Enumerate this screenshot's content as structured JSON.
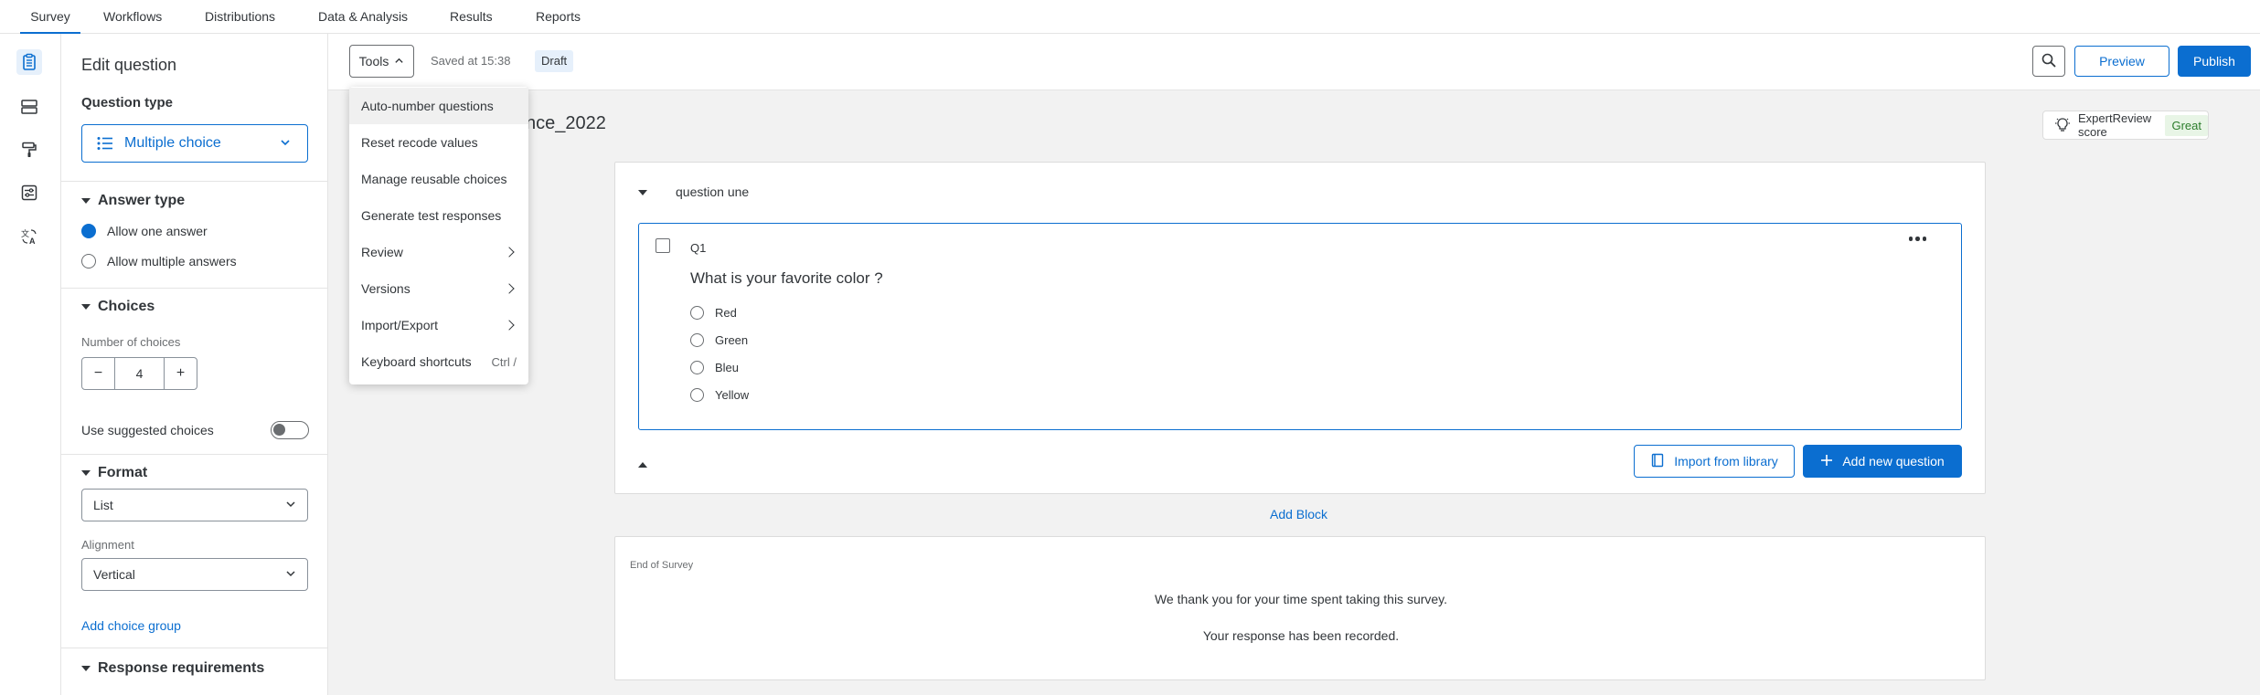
{
  "nav": {
    "tabs": [
      {
        "label": "Survey",
        "active": true
      },
      {
        "label": "Workflows"
      },
      {
        "label": "Distributions"
      },
      {
        "label": "Data & Analysis"
      },
      {
        "label": "Results"
      },
      {
        "label": "Reports"
      }
    ]
  },
  "rail": {
    "icons": [
      "survey-clipboard-icon",
      "blocks-icon",
      "paint-roller-icon",
      "survey-options-icon",
      "translate-icon"
    ]
  },
  "edit_panel": {
    "title": "Edit question",
    "question_type_heading": "Question type",
    "question_type_value": "Multiple choice",
    "answer_type": {
      "heading": "Answer type",
      "options": [
        {
          "label": "Allow one answer",
          "selected": true
        },
        {
          "label": "Allow multiple answers",
          "selected": false
        }
      ]
    },
    "choices": {
      "heading": "Choices",
      "number_label": "Number of choices",
      "number_value": "4",
      "minus": "−",
      "plus": "+",
      "suggested_label": "Use suggested choices",
      "suggested_on": false
    },
    "format": {
      "heading": "Format",
      "format_value": "List",
      "alignment_label": "Alignment",
      "alignment_value": "Vertical",
      "add_group_link": "Add choice group"
    },
    "response_requirements": "Response requirements"
  },
  "toolbar": {
    "tools_label": "Tools",
    "saved_text": "Saved at 15:38",
    "draft_badge": "Draft",
    "preview_label": "Preview",
    "publish_label": "Publish"
  },
  "tools_menu": {
    "items": [
      {
        "label": "Auto-number questions",
        "highlighted": true
      },
      {
        "label": "Reset recode values"
      },
      {
        "label": "Manage reusable choices"
      },
      {
        "label": "Generate test responses"
      },
      {
        "label": "Review",
        "submenu": true
      },
      {
        "label": "Versions",
        "submenu": true
      },
      {
        "label": "Import/Export",
        "submenu": true
      },
      {
        "label": "Keyboard shortcuts",
        "shortcut": "Ctrl /"
      }
    ]
  },
  "canvas": {
    "survey_title": "nce_2022",
    "expert_review": {
      "label": "ExpertReview score",
      "score": "Great"
    },
    "block": {
      "name": "question une",
      "question": {
        "id": "Q1",
        "text": "What is your favorite color ?",
        "choices": [
          "Red",
          "Green",
          "Bleu",
          "Yellow"
        ]
      },
      "import_label": "Import from library",
      "add_question_label": "Add new question"
    },
    "add_block": "Add Block",
    "end_of_survey": {
      "label": "End of Survey",
      "line1": "We thank you for your time spent taking this survey.",
      "line2": "Your response has been recorded."
    }
  },
  "colors": {
    "accent": "#0b6ed0",
    "score_green": "#2b7d2b",
    "score_bg": "#e8f5e6"
  }
}
